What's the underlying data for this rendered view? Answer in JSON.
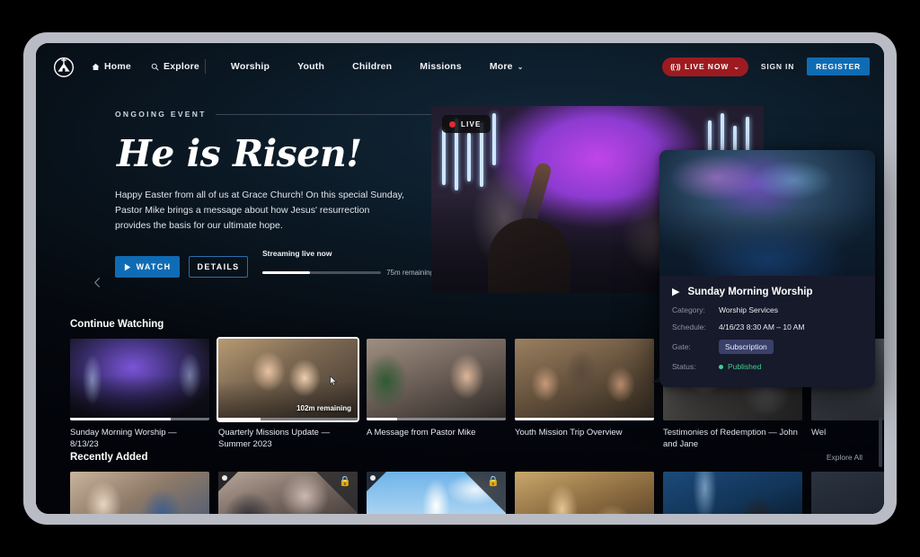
{
  "nav": {
    "logo_icon": "church-cross-logo-icon",
    "primary": [
      {
        "label": "Home",
        "icon": "home-icon"
      },
      {
        "label": "Explore",
        "icon": "search-icon"
      }
    ],
    "sections": [
      {
        "label": "Worship"
      },
      {
        "label": "Youth"
      },
      {
        "label": "Children"
      },
      {
        "label": "Missions"
      },
      {
        "label": "More",
        "caret": "⌄"
      }
    ],
    "live_now": {
      "label": "LIVE NOW",
      "signal_icon": "((·))",
      "caret": "⌄",
      "color": "#9d1b20"
    },
    "sign_in": "SIGN IN",
    "register": "REGISTER",
    "register_color": "#0f6cb4"
  },
  "hero": {
    "eyebrow": "ONGOING EVENT",
    "title": "He is Risen!",
    "description": "Happy Easter from all of us at Grace Church! On this special Sunday, Pastor Mike brings a message about how Jesus' resurrection provides the basis for our ultimate hope.",
    "watch_label": "WATCH",
    "watch_icon": "play-icon",
    "details_label": "DETAILS",
    "stream_label": "Streaming live now",
    "stream_remaining": "75m remaining",
    "stream_progress_pct": 40,
    "live_badge": "LIVE",
    "prev_icon": "chevron-left-icon",
    "dots": 3,
    "active_dot": 0
  },
  "rows": [
    {
      "title": "Continue Watching",
      "link": "",
      "cards": [
        {
          "label": "Sunday Morning Worship — 8/13/23",
          "art": "t-worship",
          "progress": 72,
          "remaining": "",
          "focused": false
        },
        {
          "label": "Quarterly Missions Update — Summer 2023",
          "art": "t-couple",
          "progress": 30,
          "remaining": "102m remaining",
          "focused": true
        },
        {
          "label": "A Message from Pastor Mike",
          "art": "t-pastor",
          "progress": 22,
          "remaining": "",
          "focused": false
        },
        {
          "label": "Youth Mission Trip Overview",
          "art": "t-mission",
          "progress": 100,
          "remaining": "",
          "focused": false
        },
        {
          "label": "Testimonies of Redemption — John and Jane",
          "art": "t-testimony",
          "progress": 0,
          "remaining": "",
          "focused": false
        },
        {
          "label": "Wel",
          "art": "t-welcome",
          "progress": 0,
          "remaining": "",
          "focused": false
        }
      ]
    },
    {
      "title": "Recently Added",
      "link": "Explore All",
      "cards": [
        {
          "label": "",
          "art": "t-hands",
          "gate": false,
          "selected": false
        },
        {
          "label": "",
          "art": "t-congregation",
          "gate": true,
          "selected": true,
          "gate_icon": "paid-lock-icon"
        },
        {
          "label": "",
          "art": "t-steeple",
          "gate": true,
          "selected": true,
          "gate_icon": "paid-lock-icon"
        },
        {
          "label": "",
          "art": "t-communion",
          "gate": false,
          "selected": false
        },
        {
          "label": "",
          "art": "t-concert",
          "gate": false,
          "selected": false
        },
        {
          "label": "",
          "art": "t-edge",
          "gate": false,
          "selected": false
        }
      ]
    }
  ],
  "popup": {
    "play_icon": "play-icon",
    "title": "Sunday Morning Worship",
    "meta": [
      {
        "key": "Category:",
        "value": "Worship Services"
      },
      {
        "key": "Schedule:",
        "value": "4/16/23  8:30 AM – 10 AM"
      }
    ],
    "gate_key": "Gate:",
    "gate_value": "Subscription",
    "status_key": "Status:",
    "status_value": "Published",
    "status_color": "#3ecf8e"
  }
}
